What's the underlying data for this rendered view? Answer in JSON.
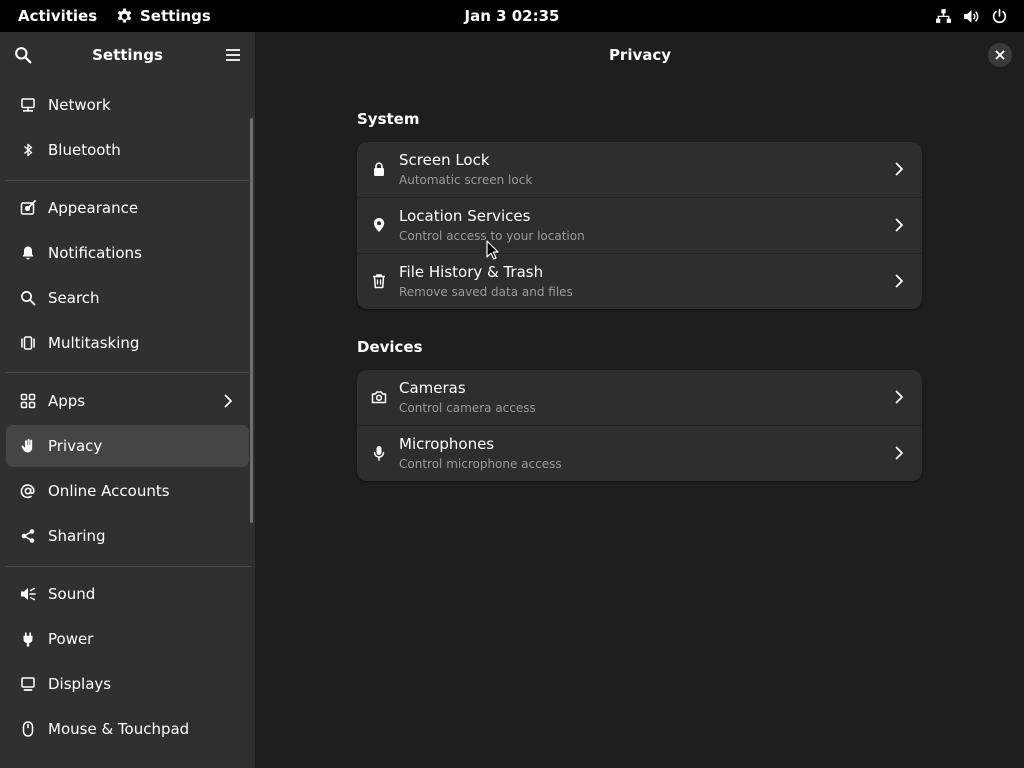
{
  "topbar": {
    "activities": "Activities",
    "app_name": "Settings",
    "clock": "Jan 3  02:35",
    "status_icons": [
      "network-icon",
      "volume-icon",
      "power-icon"
    ]
  },
  "sidebar": {
    "title": "Settings",
    "items": [
      {
        "label": "Network",
        "icon": "network-icon"
      },
      {
        "label": "Bluetooth",
        "icon": "bluetooth-icon"
      },
      {
        "label": "Appearance",
        "icon": "appearance-icon"
      },
      {
        "label": "Notifications",
        "icon": "bell-icon"
      },
      {
        "label": "Search",
        "icon": "search-icon"
      },
      {
        "label": "Multitasking",
        "icon": "multitasking-icon"
      },
      {
        "label": "Apps",
        "icon": "apps-icon"
      },
      {
        "label": "Privacy",
        "icon": "hand-icon",
        "selected": true
      },
      {
        "label": "Online Accounts",
        "icon": "at-sign-icon"
      },
      {
        "label": "Sharing",
        "icon": "share-icon"
      },
      {
        "label": "Sound",
        "icon": "speaker-icon"
      },
      {
        "label": "Power",
        "icon": "power-plug-icon"
      },
      {
        "label": "Displays",
        "icon": "display-icon"
      },
      {
        "label": "Mouse & Touchpad",
        "icon": "mouse-icon"
      }
    ]
  },
  "main": {
    "title": "Privacy",
    "sections": [
      {
        "heading": "System",
        "rows": [
          {
            "title": "Screen Lock",
            "subtitle": "Automatic screen lock",
            "icon": "lock-icon"
          },
          {
            "title": "Location Services",
            "subtitle": "Control access to your location",
            "icon": "location-pin-icon"
          },
          {
            "title": "File History & Trash",
            "subtitle": "Remove saved data and files",
            "icon": "trash-icon"
          }
        ]
      },
      {
        "heading": "Devices",
        "rows": [
          {
            "title": "Cameras",
            "subtitle": "Control camera access",
            "icon": "camera-icon"
          },
          {
            "title": "Microphones",
            "subtitle": "Control microphone access",
            "icon": "microphone-icon"
          }
        ]
      }
    ]
  },
  "colors": {
    "topbar_bg": "#000000",
    "sidebar_bg": "#303030",
    "main_bg": "#1e1e1e",
    "card_bg": "#2e2e2e",
    "selected_bg": "#454545",
    "text": "#ffffff",
    "subtext": "#9a9a9a"
  }
}
